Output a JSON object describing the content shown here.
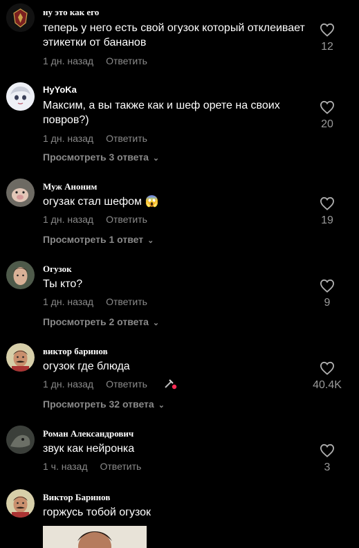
{
  "comments": [
    {
      "username": "ну это как его",
      "text": "теперь у него есть свой огузок который отклеивает этикетки от бананов",
      "time": "1 дн. назад",
      "reply": "Ответить",
      "likes": "12",
      "replies": ""
    },
    {
      "username": "HyYoKa",
      "text": "Максим, а вы также как и шеф орете на своих повров?)",
      "time": "1 дн. назад",
      "reply": "Ответить",
      "likes": "20",
      "replies": "Просмотреть 3 ответа"
    },
    {
      "username": "Муж Аноним",
      "text": "огузак стал шефом 😱",
      "time": "1 дн. назад",
      "reply": "Ответить",
      "likes": "19",
      "replies": "Просмотреть 1 ответ"
    },
    {
      "username": "Огузок",
      "text": "Ты кто?",
      "time": "1 дн. назад",
      "reply": "Ответить",
      "likes": "9",
      "replies": "Просмотреть 2 ответа"
    },
    {
      "username": "виктор баринов",
      "text": "огузок где блюда",
      "time": "1 дн. назад",
      "reply": "Ответить",
      "likes": "40.4K",
      "replies": "Просмотреть 32 ответа"
    },
    {
      "username": "Роман Александрович",
      "text": "звук как нейронка",
      "time": "1 ч. назад",
      "reply": "Ответить",
      "likes": "3",
      "replies": ""
    },
    {
      "username": "Виктор Баринов",
      "text": "горжусь тобой огузок",
      "time": "",
      "reply": "",
      "likes": "",
      "replies": ""
    }
  ],
  "icons": {
    "like": "heart-icon",
    "expand": "chevron-down-icon",
    "creator_liked": "creator-like-badge-icon"
  },
  "colors": {
    "background": "#000000",
    "muted_text": "#8a8a8a",
    "like_count": "#9a9a9a"
  }
}
